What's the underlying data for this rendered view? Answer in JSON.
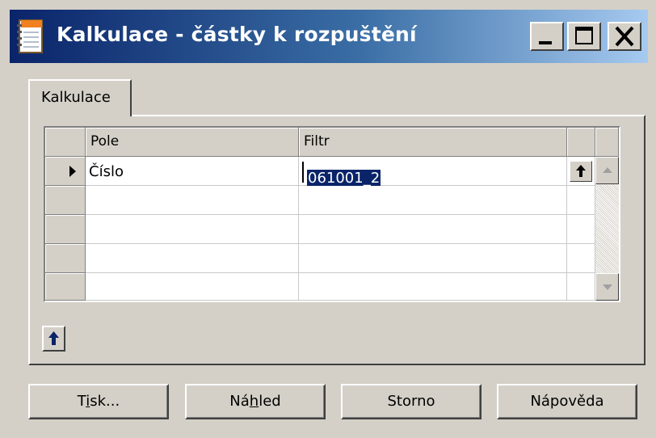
{
  "window": {
    "title": "Kalkulace - částky k rozpuštění",
    "icon": "notebook-app-icon",
    "controls": [
      "minimize-icon",
      "maximize-icon",
      "close-icon"
    ]
  },
  "tabs": [
    {
      "label": "Kalkulace",
      "active": true
    }
  ],
  "grid": {
    "columns": [
      "Pole",
      "Filtr"
    ],
    "rows": [
      {
        "field": "Číslo",
        "filter": "061001_2",
        "current": true
      },
      {
        "field": "",
        "filter": ""
      },
      {
        "field": "",
        "filter": ""
      },
      {
        "field": "",
        "filter": ""
      },
      {
        "field": "",
        "filter": ""
      }
    ]
  },
  "buttons": {
    "print": {
      "pre": "T",
      "mnemonic": "i",
      "post": "sk..."
    },
    "preview": {
      "pre": "Ná",
      "mnemonic": "h",
      "post": "led"
    },
    "cancel": "Storno",
    "help": "Nápověda"
  },
  "icons": {
    "up_arrow": "up-arrow-icon",
    "row_pointer": "row-pointer-icon",
    "scroll_up": "scroll-up-arrow-icon",
    "scroll_down": "scroll-down-arrow-icon"
  },
  "colors": {
    "title_start": "#0a246a",
    "title_end": "#a6caf0",
    "face": "#d4d0c8",
    "selection": "#0a246a"
  }
}
